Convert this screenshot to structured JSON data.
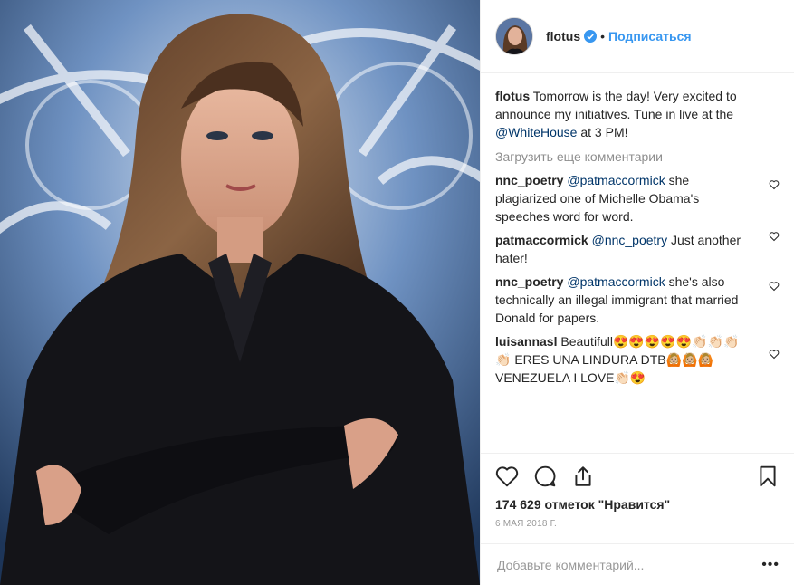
{
  "header": {
    "username": "flotus",
    "separator": "•",
    "follow_label": "Подписаться"
  },
  "caption": {
    "username": "flotus",
    "text_before": " Tomorrow is the day! Very excited to announce my initiatives. Tune in live at the ",
    "mention": "@WhiteHouse",
    "text_after": " at 3 PM!"
  },
  "load_more_label": "Загрузить еще комментарии",
  "comments": [
    {
      "username": "nnc_poetry",
      "mention": "@patmaccormick",
      "text": " she plagiarized one of Michelle Obama's speeches word for word."
    },
    {
      "username": "patmaccormick",
      "mention": "@nnc_poetry",
      "text": " Just another hater!"
    },
    {
      "username": "nnc_poetry",
      "mention": "@patmaccormick",
      "text": " she's also technically an illegal immigrant that married Donald for papers."
    },
    {
      "username": "luisannasl",
      "mention": "",
      "text": " Beautifull😍😍😍😍😍👏🏻👏🏻👏🏻👏🏻 ERES UNA LINDURA DTB🙆🏼🙆🏼🙆🏼 VENEZUELA I LOVE👏🏻😍"
    }
  ],
  "likes_text": "174 629 отметок \"Нравится\"",
  "date_text": "6 МАЯ 2018 Г.",
  "add_comment": {
    "placeholder": "Добавьте комментарий...",
    "more_label": "•••"
  },
  "icons": {
    "like": "heart-icon",
    "comment": "comment-icon",
    "share": "share-icon",
    "save": "bookmark-icon",
    "verified": "verified-badge-icon"
  },
  "colors": {
    "link": "#3897f0",
    "mention": "#003569",
    "muted": "#8e8e8e",
    "text": "#262626",
    "border": "#efefef"
  }
}
